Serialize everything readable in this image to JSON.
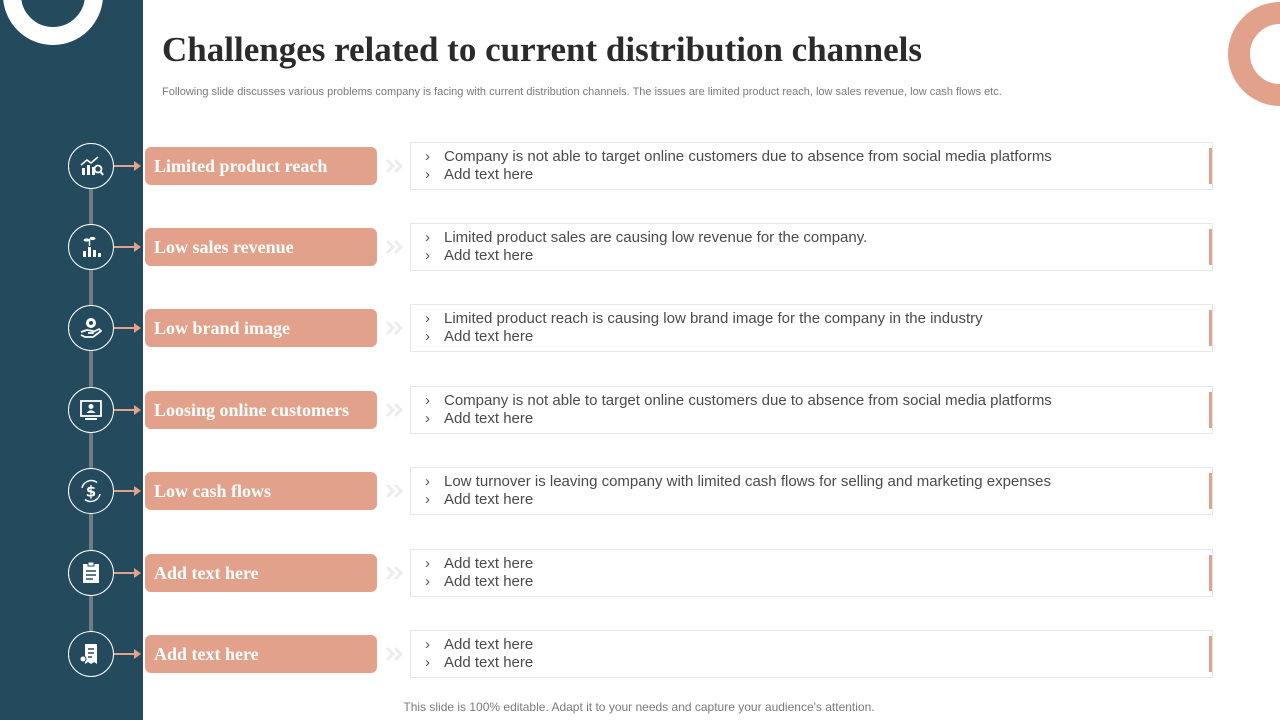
{
  "title": "Challenges related to current distribution channels",
  "subtitle": "Following slide discusses various problems company is facing with current distribution channels. The issues are limited product reach, low sales revenue, low cash flows etc.",
  "footer": "This slide is 100% editable. Adapt it to your needs and capture your audience's attention.",
  "colors": {
    "sidebar": "#244a5e",
    "accent": "#e2a18b",
    "title": "#2b2b2b"
  },
  "bullet_marker": "›",
  "rows": [
    {
      "icon": "chart-magnifier-icon",
      "label": "Limited product reach",
      "points": [
        "Company is not able to target online customers due to absence from social media platforms",
        "Add text here"
      ]
    },
    {
      "icon": "plant-growth-chart-icon",
      "label": "Low sales revenue",
      "points": [
        "Limited product sales are causing low revenue for the company.",
        "Add text here"
      ]
    },
    {
      "icon": "hand-reputation-icon",
      "label": "Low brand image",
      "points": [
        "Limited product reach is causing low brand image for the company in the industry",
        "Add text here"
      ]
    },
    {
      "icon": "online-user-monitor-icon",
      "label": "Loosing online customers",
      "points": [
        "Company is not able to target online customers due to absence from social media platforms",
        "Add text here"
      ]
    },
    {
      "icon": "dollar-cycle-icon",
      "label": "Low cash flows",
      "points": [
        "Low turnover is leaving company with limited cash flows for selling and marketing expenses",
        "Add text here"
      ]
    },
    {
      "icon": "clipboard-icon",
      "label": "Add text here",
      "points": [
        "Add text here",
        "Add text here"
      ]
    },
    {
      "icon": "receipt-document-icon",
      "label": "Add text here",
      "points": [
        "Add text here",
        "Add text here"
      ]
    }
  ]
}
